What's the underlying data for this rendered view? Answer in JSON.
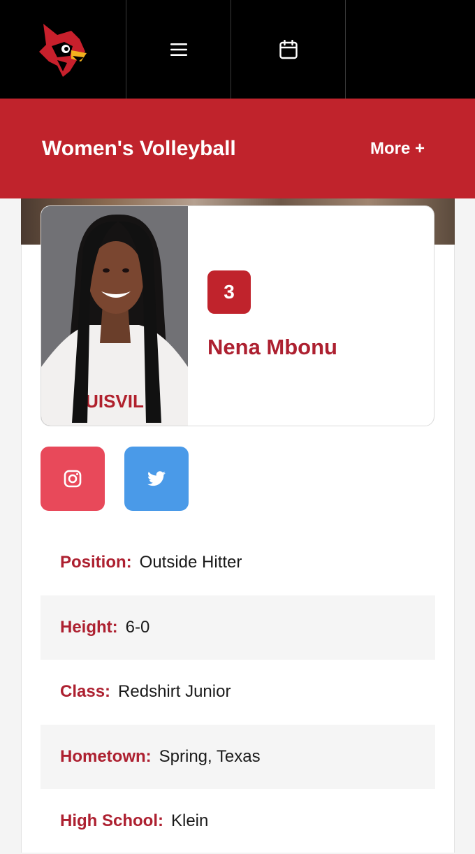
{
  "nav": {
    "logo_icon": "cardinal-bird-logo",
    "menu_icon": "hamburger-menu-icon",
    "calendar_icon": "calendar-icon"
  },
  "sport": {
    "title": "Women's Volleyball",
    "more_label": "More +"
  },
  "player": {
    "number": "3",
    "name": "Nena Mbonu",
    "jersey_text": "UISVIL"
  },
  "social": {
    "instagram_icon": "instagram-icon",
    "twitter_icon": "twitter-icon"
  },
  "bio": [
    {
      "label": "Position:",
      "value": "Outside Hitter"
    },
    {
      "label": "Height:",
      "value": "6-0"
    },
    {
      "label": "Class:",
      "value": "Redshirt Junior"
    },
    {
      "label": "Hometown:",
      "value": "Spring, Texas"
    },
    {
      "label": "High School:",
      "value": "Klein"
    }
  ],
  "colors": {
    "brand_red": "#c0232c",
    "label_red": "#ad2030",
    "instagram_bg": "#e8495a",
    "twitter_bg": "#4a9ae8"
  }
}
